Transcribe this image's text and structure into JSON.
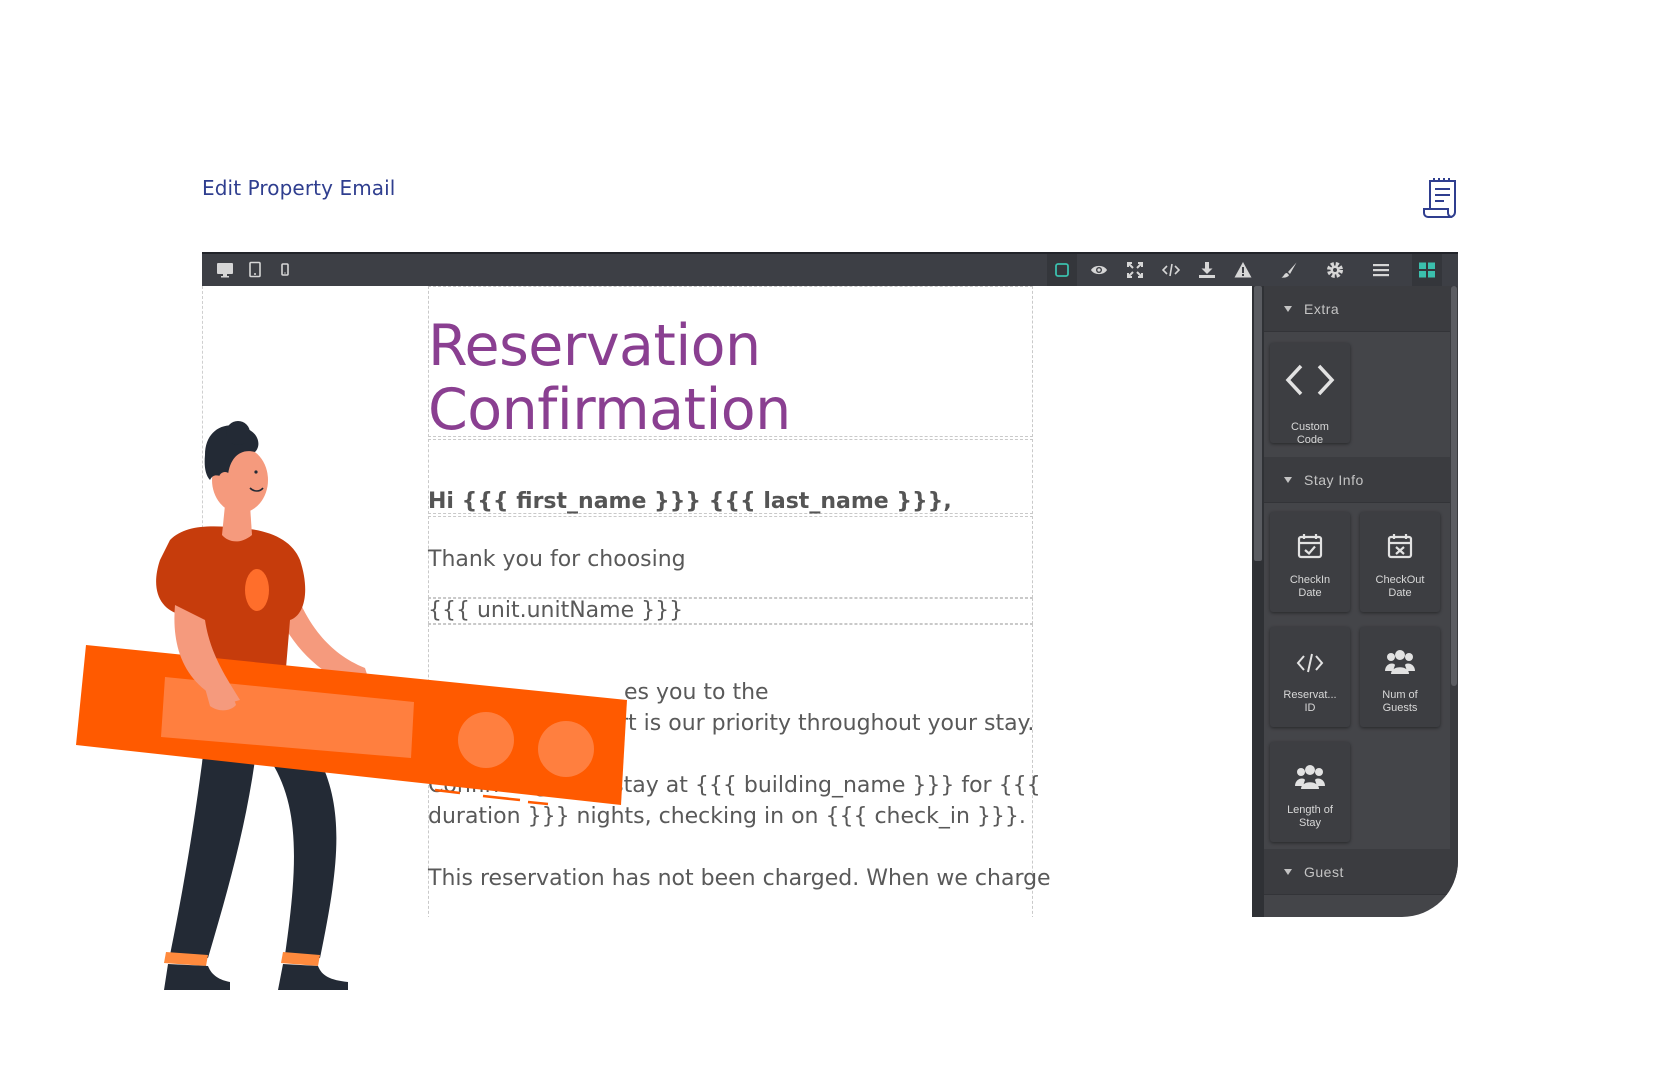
{
  "header": {
    "title": "Edit Property Email",
    "receipt_icon": "receipt-icon"
  },
  "toolbar": {
    "devices": [
      "desktop-icon",
      "tablet-icon",
      "mobile-icon"
    ],
    "actions": [
      "sw-visibility-icon",
      "preview-icon",
      "fullscreen-icon",
      "code-icon",
      "download-icon",
      "warning-icon"
    ],
    "panels": [
      "style-manager-icon",
      "settings-icon",
      "layer-manager-icon",
      "blocks-icon"
    ],
    "accent": "#3bbfad"
  },
  "email": {
    "heading": "Reservation Confirmation",
    "heading_color": "#8a3f91",
    "greeting": "Hi {{{ first_name }}} {{{ last_name }}},",
    "thanks": "Thank you for choosing",
    "unit": "{{{ unit.unitName }}}",
    "welcome_1": "es you to the",
    "welcome_2": "rt is our priority throughout your stay.",
    "confirm_1": "Confirming your stay at {{{ building_name }}} for {{{",
    "confirm_2": "duration }}} nights, checking in on {{{ check_in }}}.",
    "charge": "This reservation has not been charged. When we charge"
  },
  "blocks_panel": {
    "categories": [
      {
        "name": "Extra",
        "blocks": [
          {
            "label": "Custom Code",
            "icon": "custom-code-icon"
          }
        ]
      },
      {
        "name": "Stay Info",
        "blocks": [
          {
            "label": "CheckIn Date",
            "icon": "calendar-check-icon"
          },
          {
            "label": "CheckOut Date",
            "icon": "calendar-x-icon"
          },
          {
            "label": "Reservat... ID",
            "icon": "code-icon"
          },
          {
            "label": "Num of Guests",
            "icon": "users-icon"
          },
          {
            "label": "Length of Stay",
            "icon": "users-icon"
          }
        ]
      },
      {
        "name": "Guest",
        "blocks": []
      }
    ]
  },
  "illustration": {
    "accent": "#ff5a00",
    "icon": "person-holding-slider-illustration"
  }
}
